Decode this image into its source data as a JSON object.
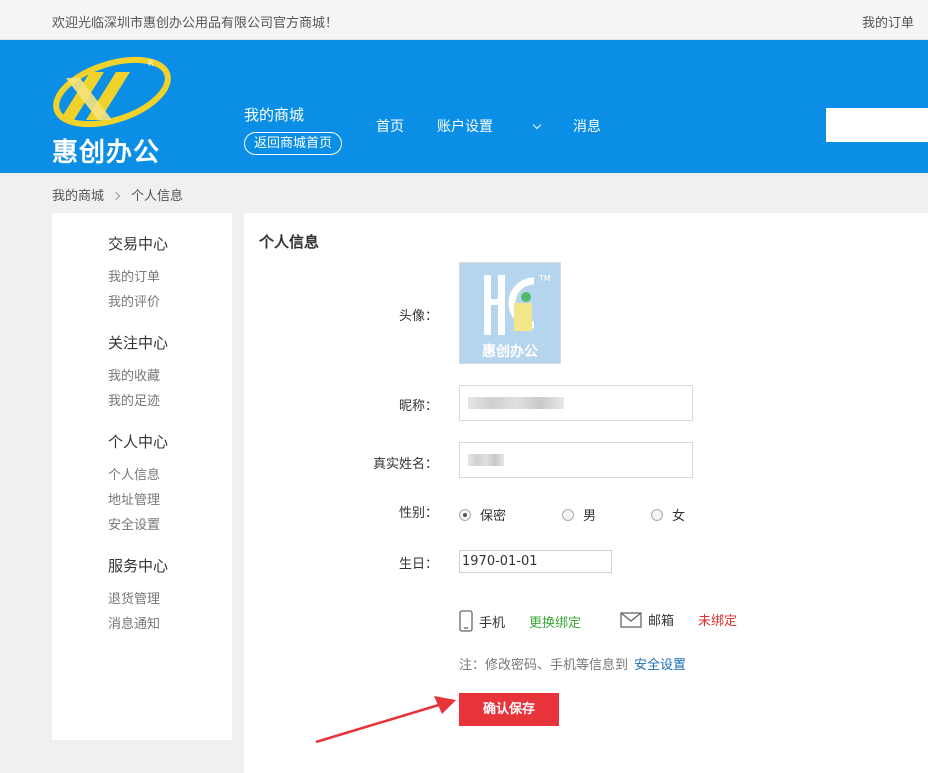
{
  "topbar": {
    "welcome": "欢迎光临深圳市惠创办公用品有限公司官方商城！",
    "my_orders": "我的订单"
  },
  "header": {
    "logo_text": "惠创办公",
    "logo_mark": "R",
    "mall_title": "我的商城",
    "back_button": "返回商城首页",
    "nav": {
      "home": "首页",
      "account": "账户设置",
      "messages": "消息"
    },
    "accent": "#0a8ee6"
  },
  "breadcrumb": {
    "root": "我的商城",
    "current": "个人信息"
  },
  "sidebar": {
    "groups": [
      {
        "title": "交易中心",
        "items": [
          "我的订单",
          "我的评价"
        ]
      },
      {
        "title": "关注中心",
        "items": [
          "我的收藏",
          "我的足迹"
        ]
      },
      {
        "title": "个人中心",
        "items": [
          "个人信息",
          "地址管理",
          "安全设置"
        ]
      },
      {
        "title": "服务中心",
        "items": [
          "退货管理",
          "消息通知"
        ]
      }
    ]
  },
  "profile": {
    "title": "个人信息",
    "avatar_label": "头像：",
    "avatar_text": "惠创办公",
    "avatar_tm": "TM",
    "nickname_label": "昵称：",
    "realname_label": "真实姓名：",
    "gender_label": "性别：",
    "gender_options": [
      "保密",
      "男",
      "女"
    ],
    "gender_selected": "保密",
    "birthday_label": "生日：",
    "birthday_value": "1970-01-01",
    "phone_label": "手机",
    "phone_action": "更换绑定",
    "email_label": "邮箱",
    "email_status": "未绑定",
    "note_text": "注：修改密码、手机等信息到",
    "note_link": "安全设置",
    "save_button": "确认保存",
    "save_color": "#e8333a"
  }
}
